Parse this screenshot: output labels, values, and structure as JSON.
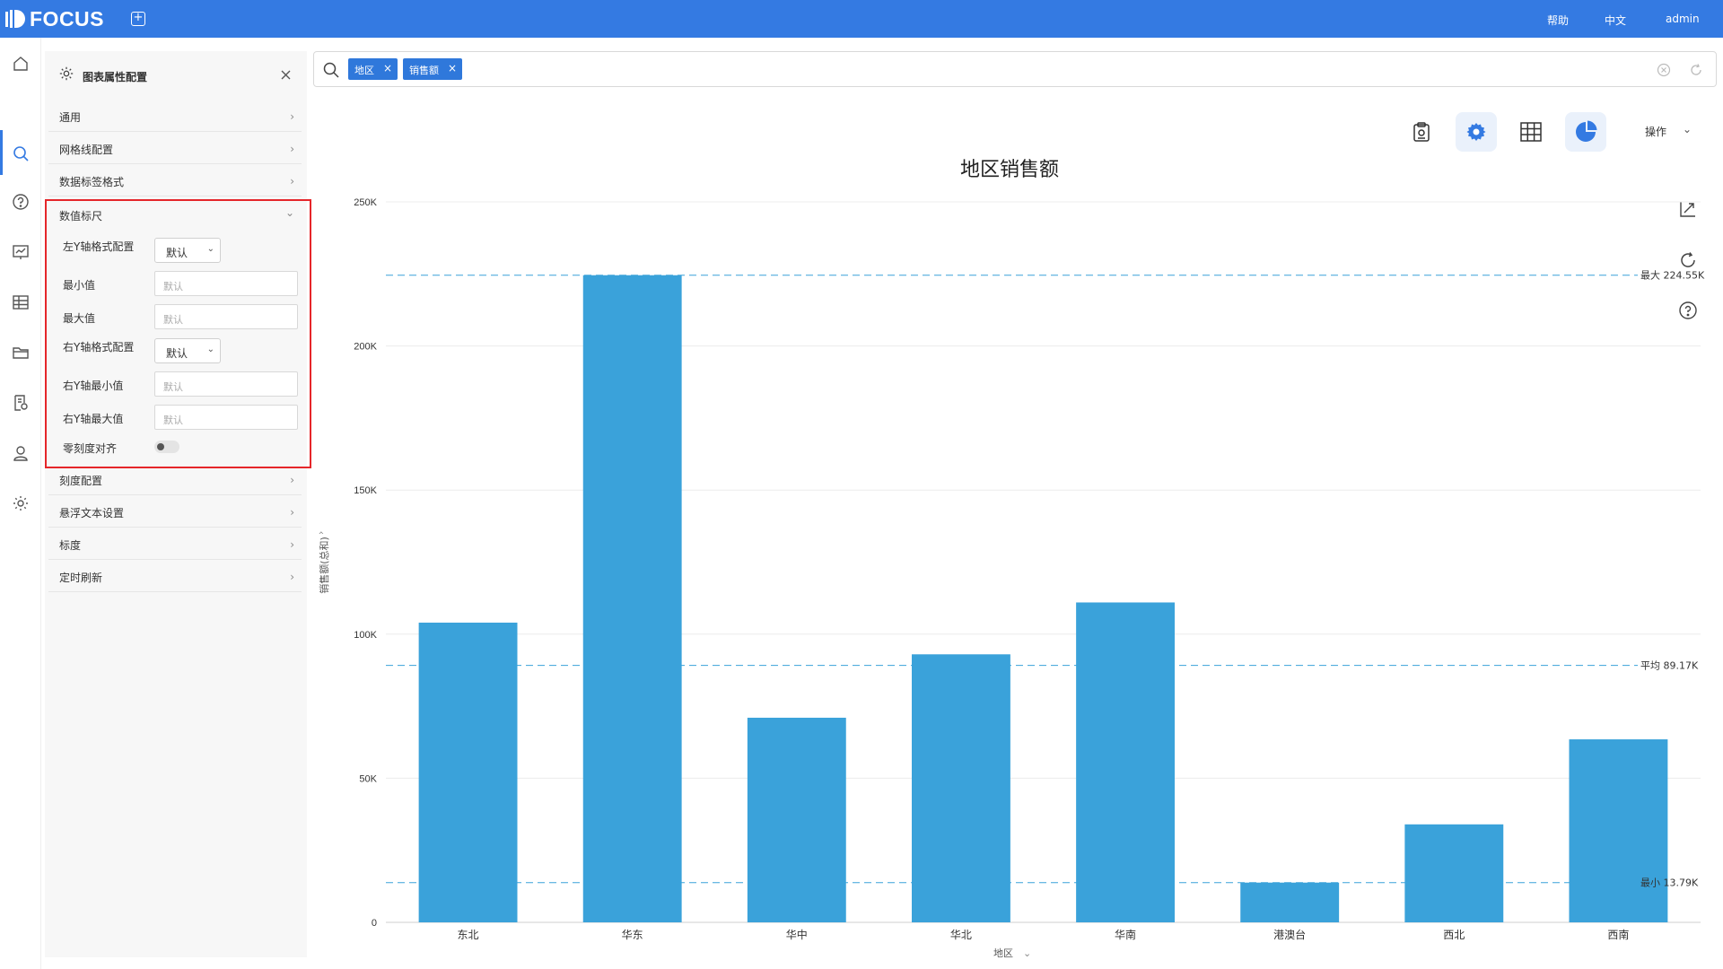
{
  "app": {
    "logo_text": "FOCUS"
  },
  "topbar": {
    "help": "帮助",
    "lang": "中文",
    "user": "admin"
  },
  "panel": {
    "title": "图表属性配置",
    "sections_top": [
      "通用",
      "网格线配置",
      "数据标签格式"
    ],
    "expanded_section": "数值标尺",
    "fields": {
      "left_y_format_label": "左Y轴格式配置",
      "left_y_format_value": "默认",
      "min_label": "最小值",
      "min_placeholder": "默认",
      "max_label": "最大值",
      "max_placeholder": "默认",
      "right_y_format_label": "右Y轴格式配置",
      "right_y_format_value": "默认",
      "right_min_label": "右Y轴最小值",
      "right_min_placeholder": "默认",
      "right_max_label": "右Y轴最大值",
      "right_max_placeholder": "默认",
      "zero_align_label": "零刻度对齐",
      "zero_align_on": false
    },
    "sections_bottom": [
      "刻度配置",
      "悬浮文本设置",
      "标度",
      "定时刷新"
    ]
  },
  "search": {
    "chips": [
      "地区",
      "销售额"
    ]
  },
  "toolbar": {
    "ops_label": "操作"
  },
  "colors": {
    "accent": "#347ae2",
    "bar": "#3aa2da",
    "highlight": "#e5262a"
  },
  "chart_data": {
    "type": "bar",
    "title": "地区销售额",
    "xlabel": "地区",
    "ylabel": "销售额(总和)",
    "categories": [
      "东北",
      "华东",
      "华中",
      "华北",
      "华南",
      "港澳台",
      "西北",
      "西南"
    ],
    "values": [
      104000,
      224550,
      71000,
      93000,
      111000,
      13790,
      34000,
      63500
    ],
    "ylim": [
      0,
      250000
    ],
    "yticks": [
      0,
      50000,
      100000,
      150000,
      200000,
      250000
    ],
    "ytick_labels": [
      "0",
      "50K",
      "100K",
      "150K",
      "200K",
      "250K"
    ],
    "reference_lines": [
      {
        "label": "最大 224.55K",
        "value": 224550
      },
      {
        "label": "平均 89.17K",
        "value": 89170
      },
      {
        "label": "最小 13.79K",
        "value": 13790
      }
    ]
  }
}
